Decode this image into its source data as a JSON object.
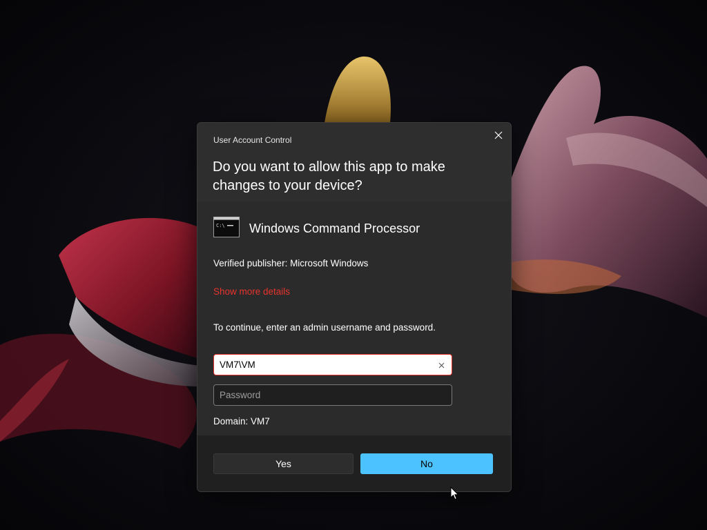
{
  "dialog": {
    "title": "User Account Control",
    "question": "Do you want to allow this app to make changes to your device?",
    "close_icon": "close-icon"
  },
  "app": {
    "icon": "command-prompt-icon",
    "name": "Windows Command Processor",
    "publisher": "Verified publisher: Microsoft Windows",
    "more_details": "Show more details"
  },
  "credentials": {
    "instruction": "To continue, enter an admin username and password.",
    "username_value": "VM7\\VM",
    "password_placeholder": "Password",
    "domain": "Domain: VM7"
  },
  "buttons": {
    "yes": "Yes",
    "no": "No"
  },
  "colors": {
    "accent": "#4cc2ff",
    "link": "#e8332d",
    "dialog_bg": "#2b2b2b"
  }
}
